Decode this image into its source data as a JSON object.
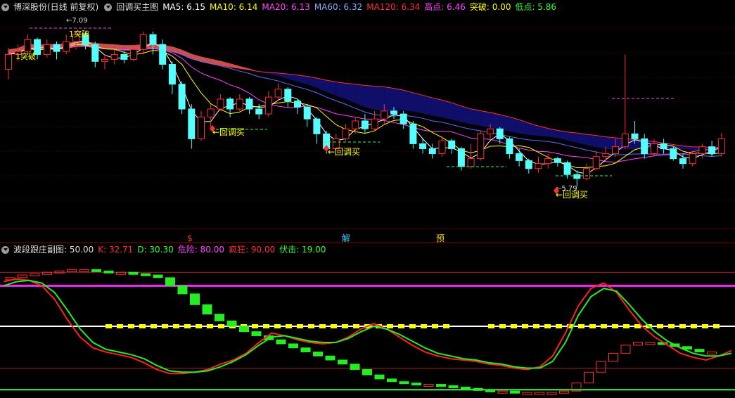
{
  "main_header": {
    "stock": "博深股份(日线 前复权)",
    "indicator": "回调买主图",
    "items": [
      {
        "label": "MA5: 6.15",
        "color": "#ffffff"
      },
      {
        "label": "MA10: 6.14",
        "color": "#ffff00"
      },
      {
        "label": "MA20: 6.13",
        "color": "#ff44ff"
      },
      {
        "label": "MA60: 6.32",
        "color": "#8fa8ff"
      },
      {
        "label": "MA120: 6.34",
        "color": "#ff3030"
      },
      {
        "label": "高点: 6.46",
        "color": "#ff44ff"
      },
      {
        "label": "突破: 0.00",
        "color": "#ffff00"
      },
      {
        "label": "低点: 5.86",
        "color": "#33ff33"
      }
    ]
  },
  "sub_header": {
    "indicator": "波段跟庄副图",
    "value": ": 50.00",
    "items": [
      {
        "label": "K: 32.71",
        "color": "#ff3030"
      },
      {
        "label": "D: 30.30",
        "color": "#33ff33"
      },
      {
        "label": "危险: 80.00",
        "color": "#ff44ff"
      },
      {
        "label": "疯狂: 90.00",
        "color": "#ff3030"
      },
      {
        "label": "伏击: 19.00",
        "color": "#33ff33"
      }
    ]
  },
  "marker_labels": [
    {
      "text": "$",
      "color": "#ff3030"
    },
    {
      "text": "解",
      "color": "#33ccff"
    },
    {
      "text": "预",
      "color": "#ffcc00"
    }
  ],
  "annotations": [
    {
      "text": "1突破",
      "color": "#ffff00"
    },
    {
      "text": "1突破",
      "color": "#ffff00"
    },
    {
      "text": "7.09",
      "color": "#dddddd"
    },
    {
      "text": "回调买",
      "color": "#ffff00"
    },
    {
      "text": "回调买",
      "color": "#ffff00"
    },
    {
      "text": "5.79",
      "color": "#dddddd"
    },
    {
      "text": "回调买",
      "color": "#ffff00"
    }
  ],
  "colors": {
    "up": "#ff3030",
    "down": "#54ffff",
    "background": "#000000"
  },
  "chart_data": {
    "type": "candlestick",
    "candles": [
      [
        6.7,
        6.85,
        6.92,
        6.6
      ],
      [
        6.85,
        6.88,
        6.95,
        6.78
      ],
      [
        6.88,
        7.0,
        7.05,
        6.85
      ],
      [
        7.0,
        6.85,
        7.02,
        6.8
      ],
      [
        6.85,
        6.95,
        7.0,
        6.82
      ],
      [
        6.95,
        6.88,
        6.98,
        6.8
      ],
      [
        6.88,
        6.98,
        7.05,
        6.85
      ],
      [
        6.98,
        7.05,
        7.09,
        6.9
      ],
      [
        7.05,
        6.95,
        7.08,
        6.9
      ],
      [
        6.95,
        6.78,
        6.98,
        6.72
      ],
      [
        6.78,
        6.8,
        6.85,
        6.7
      ],
      [
        6.8,
        6.85,
        6.9,
        6.75
      ],
      [
        6.85,
        6.8,
        6.88,
        6.76
      ],
      [
        6.8,
        6.9,
        6.95,
        6.78
      ],
      [
        6.9,
        7.05,
        7.08,
        6.85
      ],
      [
        7.05,
        6.95,
        7.08,
        6.85
      ],
      [
        6.95,
        6.75,
        7.0,
        6.7
      ],
      [
        6.75,
        6.55,
        6.78,
        6.45
      ],
      [
        6.55,
        6.3,
        6.58,
        6.25
      ],
      [
        6.3,
        6.0,
        6.35,
        5.9
      ],
      [
        6.0,
        6.22,
        6.28,
        5.98
      ],
      [
        6.22,
        6.3,
        6.35,
        6.1
      ],
      [
        6.3,
        6.4,
        6.45,
        6.28
      ],
      [
        6.4,
        6.3,
        6.42,
        6.22
      ],
      [
        6.3,
        6.4,
        6.45,
        6.28
      ],
      [
        6.4,
        6.3,
        6.42,
        6.25
      ],
      [
        6.3,
        6.25,
        6.35,
        6.2
      ],
      [
        6.25,
        6.42,
        6.48,
        6.22
      ],
      [
        6.42,
        6.5,
        6.56,
        6.38
      ],
      [
        6.5,
        6.38,
        6.52,
        6.32
      ],
      [
        6.38,
        6.32,
        6.4,
        6.25
      ],
      [
        6.32,
        6.2,
        6.35,
        6.12
      ],
      [
        6.2,
        6.05,
        6.22,
        5.95
      ],
      [
        6.05,
        5.9,
        6.08,
        5.85
      ],
      [
        5.9,
        6.0,
        6.05,
        5.88
      ],
      [
        6.0,
        6.1,
        6.15,
        5.98
      ],
      [
        6.1,
        6.18,
        6.22,
        6.05
      ],
      [
        6.18,
        6.1,
        6.25,
        6.05
      ],
      [
        6.1,
        6.2,
        6.28,
        6.08
      ],
      [
        6.2,
        6.28,
        6.35,
        6.15
      ],
      [
        6.28,
        6.25,
        6.32,
        6.2
      ],
      [
        6.25,
        6.15,
        6.28,
        6.1
      ],
      [
        6.15,
        5.95,
        6.18,
        5.9
      ],
      [
        5.95,
        5.9,
        6.0,
        5.85
      ],
      [
        5.9,
        5.85,
        5.95,
        5.8
      ],
      [
        5.85,
        5.98,
        6.02,
        5.82
      ],
      [
        5.98,
        5.9,
        6.0,
        5.85
      ],
      [
        5.9,
        5.72,
        5.92,
        5.68
      ],
      [
        5.72,
        5.8,
        5.95,
        5.7
      ],
      [
        5.8,
        6.05,
        6.08,
        5.78
      ],
      [
        6.05,
        6.1,
        6.15,
        6.0
      ],
      [
        6.1,
        6.0,
        6.12,
        5.95
      ],
      [
        6.0,
        5.85,
        6.02,
        5.8
      ],
      [
        5.85,
        5.78,
        5.9,
        5.72
      ],
      [
        5.78,
        5.7,
        5.8,
        5.65
      ],
      [
        5.7,
        5.75,
        5.82,
        5.66
      ],
      [
        5.75,
        5.8,
        5.85,
        5.7
      ],
      [
        5.8,
        5.76,
        5.82,
        5.72
      ],
      [
        5.76,
        5.64,
        5.78,
        5.6
      ],
      [
        5.64,
        5.6,
        5.68,
        5.52
      ],
      [
        5.6,
        5.7,
        5.75,
        5.58
      ],
      [
        5.7,
        5.82,
        5.88,
        5.68
      ],
      [
        5.82,
        5.85,
        5.92,
        5.78
      ],
      [
        5.85,
        5.92,
        6.0,
        5.82
      ],
      [
        5.92,
        6.05,
        6.85,
        5.9
      ],
      [
        6.05,
        6.0,
        6.18,
        5.95
      ],
      [
        6.0,
        5.85,
        6.05,
        5.8
      ],
      [
        5.85,
        5.95,
        6.0,
        5.82
      ],
      [
        5.95,
        5.9,
        6.0,
        5.85
      ],
      [
        5.9,
        5.8,
        5.92,
        5.78
      ],
      [
        5.8,
        5.75,
        5.85,
        5.7
      ],
      [
        5.75,
        5.85,
        5.88,
        5.72
      ],
      [
        5.85,
        5.92,
        5.95,
        5.8
      ],
      [
        5.92,
        5.85,
        5.98,
        5.82
      ],
      [
        5.85,
        6.0,
        6.06,
        5.82
      ]
    ],
    "kd_k": [
      83,
      85,
      84,
      80,
      70,
      55,
      42,
      34,
      31,
      29,
      27,
      23,
      18,
      15,
      15,
      16,
      18,
      22,
      25,
      30,
      38,
      45,
      43,
      40,
      38,
      37,
      38,
      42,
      48,
      52,
      48,
      42,
      36,
      31,
      28,
      26,
      25,
      24,
      22,
      21,
      19,
      18,
      20,
      28,
      45,
      65,
      78,
      82,
      75,
      62,
      50,
      42,
      36,
      30,
      27,
      25,
      28,
      32
    ],
    "kd_d": [
      80,
      83,
      84,
      82,
      75,
      62,
      48,
      38,
      33,
      31,
      29,
      26,
      21,
      17,
      16,
      16,
      17,
      20,
      24,
      29,
      36,
      42,
      43,
      41,
      39,
      38,
      38,
      41,
      46,
      50,
      48,
      44,
      39,
      34,
      30,
      28,
      26,
      25,
      23,
      22,
      20,
      19,
      19,
      24,
      38,
      58,
      72,
      78,
      76,
      66,
      55,
      46,
      39,
      34,
      30,
      28,
      28,
      30
    ],
    "kd_levels": {
      "危险": 80,
      "疯狂": 90,
      "伏击": 19,
      "mid": 50
    }
  }
}
